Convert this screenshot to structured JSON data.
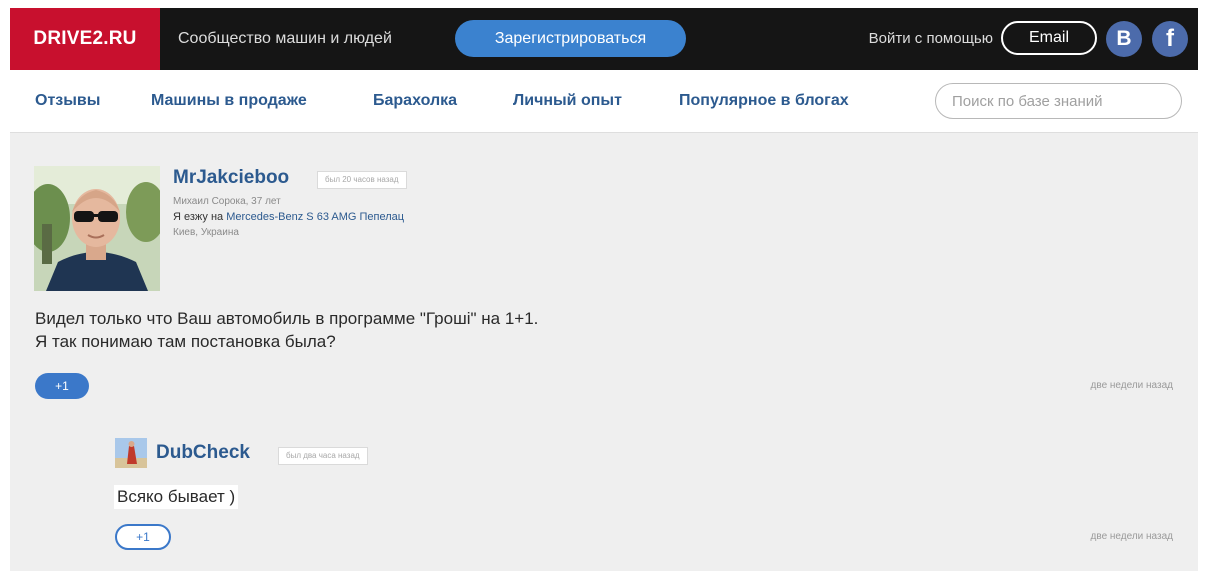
{
  "header": {
    "logo": "DRIVE2.RU",
    "tagline": "Сообщество машин и людей",
    "register_label": "Зарегистрироваться",
    "login_label": "Войти с помощью",
    "email_label": "Email",
    "vk_label": "B",
    "fb_label": "f"
  },
  "nav": {
    "items": [
      {
        "label": "Отзывы"
      },
      {
        "label": "Машины в продаже"
      },
      {
        "label": "Барахолка"
      },
      {
        "label": "Личный опыт"
      },
      {
        "label": "Популярное в блогах"
      }
    ],
    "search_placeholder": "Поиск по базе знаний"
  },
  "comment": {
    "author": "MrJakcieboo",
    "last_seen": "был 20 часов назад",
    "real_name": "Михаил Сорока, 37 лет",
    "drives_prefix": "Я езжу на",
    "car": "Mercedes-Benz S 63 AMG Пепелац",
    "location": "Киев, Украина",
    "text_lines": [
      "Видел только что Ваш автомобиль в программе \"Гроші\" на 1+1.",
      "Я так понимаю там постановка была?"
    ],
    "plus_label": "+1",
    "time": "две недели назад"
  },
  "reply": {
    "author": "DubCheck",
    "last_seen": "был два часа назад",
    "text": "Всяко бывает )",
    "plus_label": "+1",
    "time": "две недели назад"
  },
  "colors": {
    "brand": "#c8102e",
    "accent": "#3b82cf",
    "link": "#2c5a8f",
    "social": "#4c6bab"
  }
}
